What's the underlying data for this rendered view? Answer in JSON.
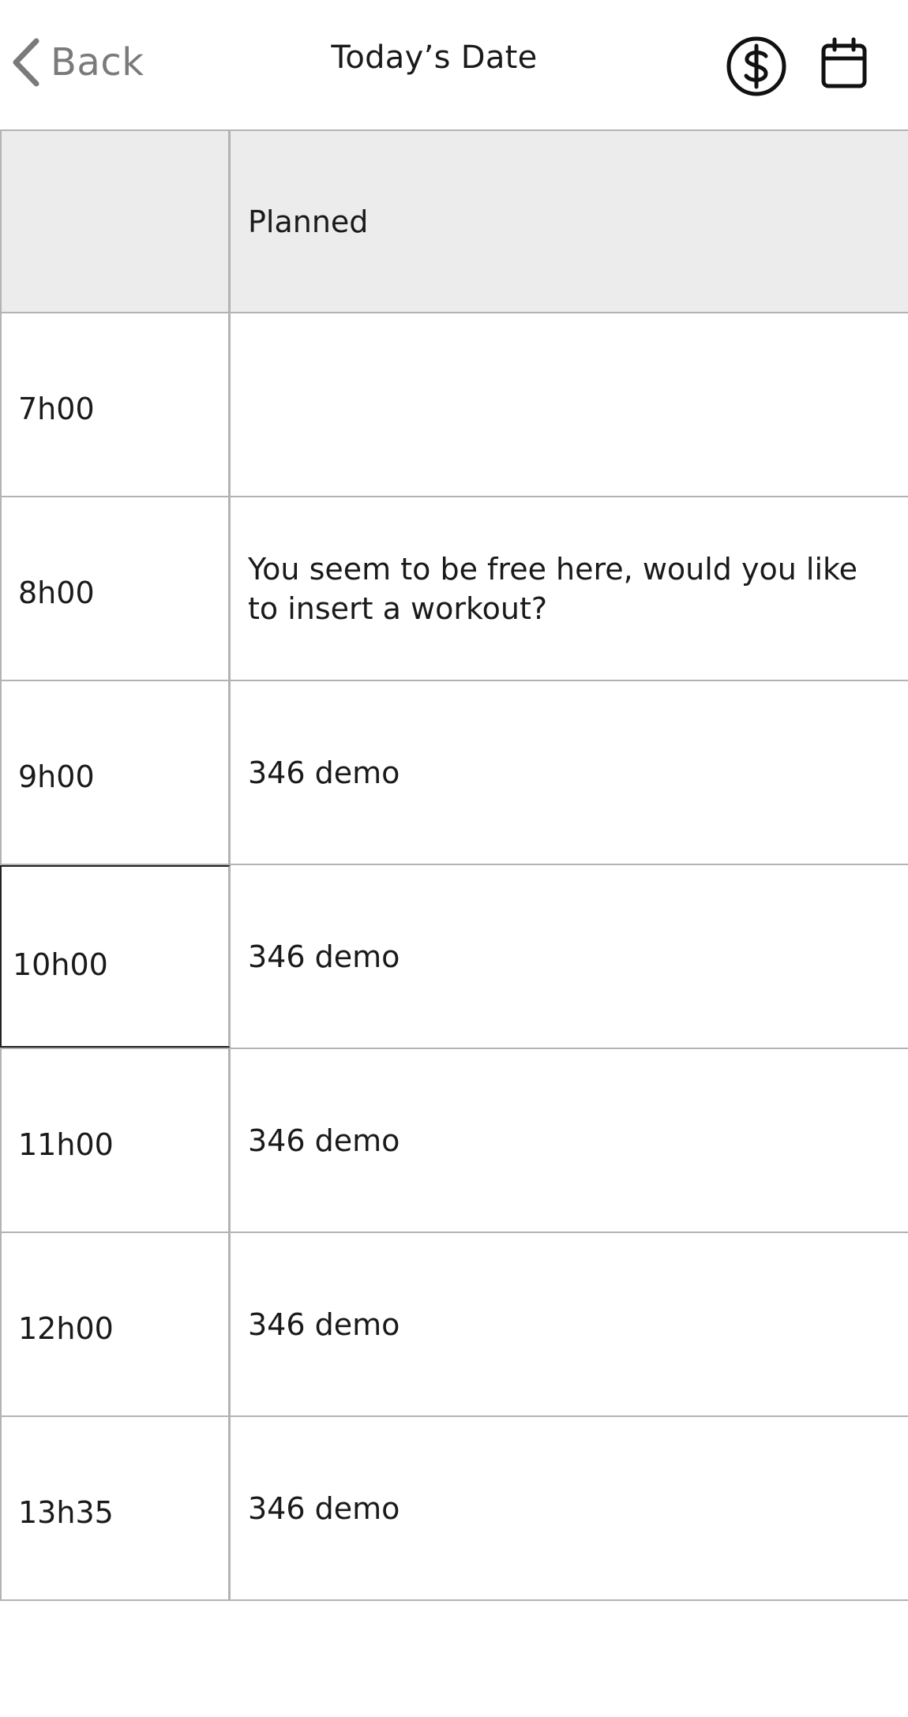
{
  "header": {
    "back_label": "Back",
    "title": "Today’s Date",
    "icons": {
      "back": "chevron-left-icon",
      "pricing": "dollar-circle-icon",
      "calendar": "calendar-icon"
    }
  },
  "schedule": {
    "columns": {
      "time": "",
      "planned": "Planned"
    },
    "rows": [
      {
        "time": "7h00",
        "planned": ""
      },
      {
        "time": "8h00",
        "planned": "You seem to be free here, would you like to insert a workout?"
      },
      {
        "time": "9h00",
        "planned": "346 demo"
      },
      {
        "time": "10h00",
        "planned": "346 demo"
      },
      {
        "time": "11h00",
        "planned": "346 demo"
      },
      {
        "time": "12h00",
        "planned": "346 demo"
      },
      {
        "time": "13h35",
        "planned": "346 demo"
      }
    ]
  },
  "colors": {
    "header_row_bg": "#ececec",
    "grid_line": "#b3b3b3",
    "back_text": "#7a7a7a",
    "text": "#1a1a1a"
  }
}
